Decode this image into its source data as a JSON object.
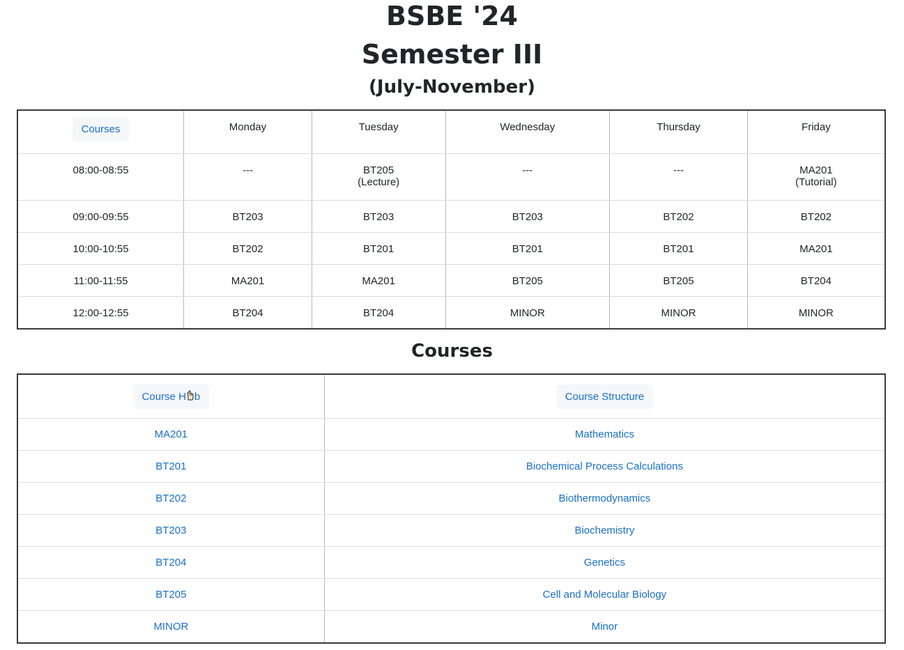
{
  "header": {
    "title": "BSBE '24",
    "semester": "Semester III",
    "period": "(July-November)"
  },
  "timetable": {
    "corner_button": "Courses",
    "days": [
      "Monday",
      "Tuesday",
      "Wednesday",
      "Thursday",
      "Friday"
    ],
    "rows": [
      {
        "time": "08:00-08:55",
        "cells": [
          [
            "---"
          ],
          [
            "BT205",
            "(Lecture)"
          ],
          [
            "---"
          ],
          [
            "---"
          ],
          [
            "MA201",
            "(Tutorial)"
          ]
        ]
      },
      {
        "time": "09:00-09:55",
        "cells": [
          [
            "BT203"
          ],
          [
            "BT203"
          ],
          [
            "BT203"
          ],
          [
            "BT202"
          ],
          [
            "BT202"
          ]
        ]
      },
      {
        "time": "10:00-10:55",
        "cells": [
          [
            "BT202"
          ],
          [
            "BT201"
          ],
          [
            "BT201"
          ],
          [
            "BT201"
          ],
          [
            "MA201"
          ]
        ]
      },
      {
        "time": "11:00-11:55",
        "cells": [
          [
            "MA201"
          ],
          [
            "MA201"
          ],
          [
            "BT205"
          ],
          [
            "BT205"
          ],
          [
            "BT204"
          ]
        ]
      },
      {
        "time": "12:00-12:55",
        "cells": [
          [
            "BT204"
          ],
          [
            "BT204"
          ],
          [
            "MINOR"
          ],
          [
            "MINOR"
          ],
          [
            "MINOR"
          ]
        ]
      }
    ]
  },
  "courses": {
    "heading": "Courses",
    "hub_button_prefix": "Course H",
    "hub_button_suffix": "b",
    "structure_button": "Course Structure",
    "items": [
      {
        "code": "MA201",
        "name": "Mathematics"
      },
      {
        "code": "BT201",
        "name": "Biochemical Process Calculations"
      },
      {
        "code": "BT202",
        "name": "Biothermodynamics"
      },
      {
        "code": "BT203",
        "name": "Biochemistry"
      },
      {
        "code": "BT204",
        "name": "Genetics"
      },
      {
        "code": "BT205",
        "name": "Cell and Molecular Biology"
      },
      {
        "code": "MINOR",
        "name": "Minor"
      }
    ]
  },
  "colors": {
    "link": "#1a6fc9",
    "button_bg": "#f5f7f9",
    "table_border": "#3a3a3a"
  }
}
